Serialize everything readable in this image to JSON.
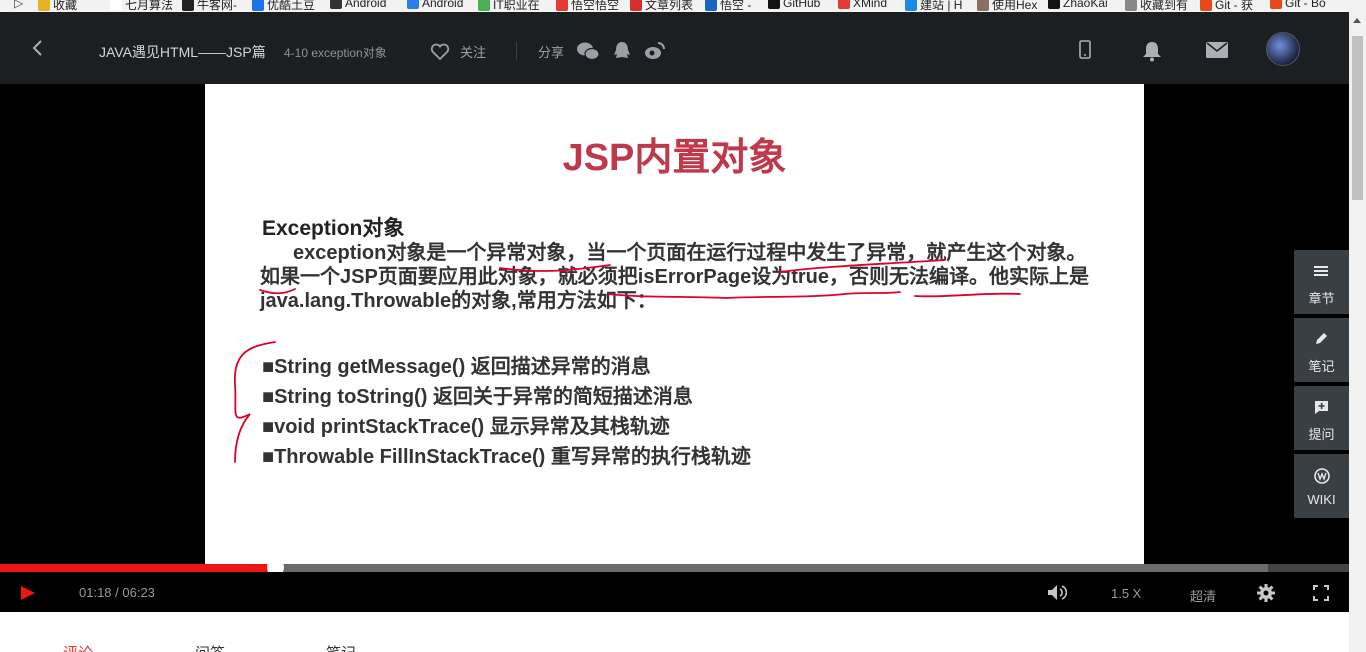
{
  "bookmarks": [
    {
      "label": "收藏",
      "color": "#e6b422"
    },
    {
      "label": "七月算法",
      "color": "#ffffff"
    },
    {
      "label": "牛客网-",
      "color": "#222222"
    },
    {
      "label": "优酷土豆",
      "color": "#1a73e8"
    },
    {
      "label": "Android",
      "color": "#333333"
    },
    {
      "label": "Android",
      "color": "#2b7de9"
    },
    {
      "label": "IT职业在",
      "color": "#4caf50"
    },
    {
      "label": "悟空悟空",
      "color": "#e53935"
    },
    {
      "label": "文章列表",
      "color": "#d32f2f"
    },
    {
      "label": "悟空 -",
      "color": "#1565c0"
    },
    {
      "label": "GitHub",
      "color": "#111111"
    },
    {
      "label": "XMind",
      "color": "#e53935"
    },
    {
      "label": "建站 | H",
      "color": "#1e88e5"
    },
    {
      "label": "使用Hex",
      "color": "#8d6e63"
    },
    {
      "label": "ZhaoKai",
      "color": "#111111"
    },
    {
      "label": "收藏到有",
      "color": "#888888"
    },
    {
      "label": "Git - 获",
      "color": "#e64a19"
    },
    {
      "label": "Git - Bo",
      "color": "#e64a19"
    }
  ],
  "header": {
    "course_title": "JAVA遇见HTML——JSP篇",
    "lesson": "4-10 exception对象",
    "follow_label": "关注",
    "share_label": "分享"
  },
  "slide": {
    "title": "JSP内置对象",
    "heading": "Exception对象",
    "paragraph": "exception对象是一个异常对象，当一个页面在运行过程中发生了异常，就产生这个对象。如果一个JSP页面要应用此对象，就必须把isErrorPage设为true，否则无法编译。他实际上是java.lang.Throwable的对象,常用方法如下：",
    "methods": [
      "■String getMessage() 返回描述异常的消息",
      "■String toString() 返回关于异常的简短描述消息",
      "■void printStackTrace() 显示异常及其栈轨迹",
      "■Throwable FillInStackTrace() 重写异常的执行栈轨迹"
    ]
  },
  "side_panel": [
    {
      "label": "章节",
      "icon": "menu-icon"
    },
    {
      "label": "笔记",
      "icon": "pencil-icon"
    },
    {
      "label": "提问",
      "icon": "question-icon"
    },
    {
      "label": "WIKI",
      "icon": "wiki-icon"
    }
  ],
  "player": {
    "time": "01:18 / 06:23",
    "played_fraction": 0.204,
    "buffered_fraction": 0.94,
    "speed": "1.5 X",
    "quality": "超清"
  },
  "tabs": [
    "评论",
    "问答",
    "笔记"
  ],
  "colors": {
    "progress": "#f01414",
    "title_red": "#c0394b",
    "ink": "#e0002a"
  }
}
